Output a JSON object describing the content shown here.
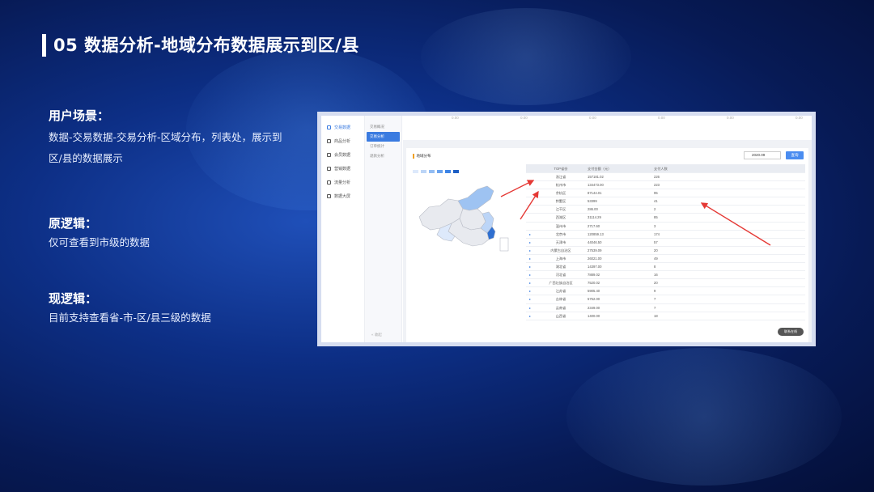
{
  "slide": {
    "title": "05 数据分析-地域分布数据展示到区/县",
    "sections": [
      {
        "heading": "用户场景：",
        "text": "数据-交易数据-交易分析-区域分布，列表处，展示到区/县的数据展示"
      },
      {
        "heading": "原逻辑：",
        "text": "仅可查看到市级的数据"
      },
      {
        "heading": "现逻辑：",
        "text": "目前支持查看省-市-区/县三级的数据"
      }
    ]
  },
  "app": {
    "nav": [
      "交易数据",
      "商品分析",
      "会员数据",
      "营销数据",
      "流量分析",
      "数据大屏"
    ],
    "sub_nav": [
      "交易概况",
      "交易分析",
      "订单统计",
      "退款分析"
    ],
    "collapse": "收起",
    "top_values": [
      "0.00",
      "0.00",
      "0.00",
      "0.00",
      "0.00",
      "0.00",
      "0.00"
    ],
    "panel_title": "地域分布",
    "date": "2020.09",
    "query_button": "查询",
    "share_button": "联系在线",
    "legend_colors": [
      "#dde9fb",
      "#bcd5f7",
      "#93bdf3",
      "#6aa3ee",
      "#3d84e6",
      "#1e5fc4"
    ],
    "table": {
      "headers": [
        "TOP省份",
        "支付金额（元）",
        "支付人数"
      ],
      "rows": [
        [
          "",
          "浙江省",
          "157181.02",
          "226"
        ],
        [
          "",
          "杭州市",
          "134473.00",
          "223"
        ],
        [
          "",
          "余杭区",
          "87144.01",
          "95"
        ],
        [
          "",
          "拱墅区",
          "53399",
          "41"
        ],
        [
          "",
          "江干区",
          "286.00",
          "2"
        ],
        [
          "",
          "西湖区",
          "31114.29",
          "85"
        ],
        [
          "",
          "温州市",
          "2717.60",
          "3"
        ],
        [
          "▸",
          "北京市",
          "120859.13",
          "174"
        ],
        [
          "▸",
          "天津市",
          "44046.50",
          "57"
        ],
        [
          "▸",
          "内蒙古自治区",
          "27539.09",
          "20"
        ],
        [
          "▸",
          "上海市",
          "26021.00",
          "49"
        ],
        [
          "▸",
          "湖北省",
          "14397.00",
          "8"
        ],
        [
          "▸",
          "河北省",
          "7889.02",
          "16"
        ],
        [
          "▸",
          "广西壮族自治区",
          "7520.02",
          "20"
        ],
        [
          "▸",
          "江苏省",
          "5905.40",
          "9"
        ],
        [
          "▸",
          "吉林省",
          "5752.00",
          "7"
        ],
        [
          "▸",
          "云南省",
          "2349.00",
          "7"
        ],
        [
          "▸",
          "山西省",
          "1400.00",
          "18"
        ]
      ]
    }
  }
}
